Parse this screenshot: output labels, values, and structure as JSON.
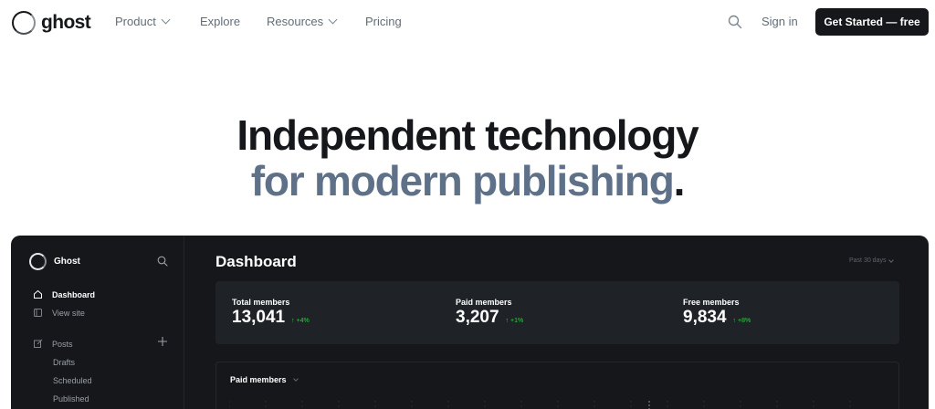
{
  "nav": {
    "brand": "ghost",
    "items": [
      {
        "label": "Product",
        "dropdown": true
      },
      {
        "label": "Explore",
        "dropdown": false
      },
      {
        "label": "Resources",
        "dropdown": true
      },
      {
        "label": "Pricing",
        "dropdown": false
      }
    ],
    "search_icon": "search-icon",
    "signin": "Sign in",
    "cta": "Get Started — free"
  },
  "hero": {
    "line1": "Independent technology",
    "line2": "for modern publishing",
    "period": "."
  },
  "dashboard": {
    "brand": "Ghost",
    "sidebar": {
      "items": [
        {
          "label": "Dashboard",
          "icon": "home-icon",
          "active": true
        },
        {
          "label": "View site",
          "icon": "browser-icon",
          "active": false
        },
        {
          "label": "Posts",
          "icon": "edit-icon",
          "active": false
        }
      ],
      "post_subitems": [
        "Drafts",
        "Scheduled",
        "Published"
      ]
    },
    "title": "Dashboard",
    "range": "Past 30 days",
    "stats": [
      {
        "label": "Total members",
        "value": "13,041",
        "delta": "+4%"
      },
      {
        "label": "Paid members",
        "value": "3,207",
        "delta": "+1%"
      },
      {
        "label": "Free members",
        "value": "9,834",
        "delta": "+8%"
      }
    ],
    "chart_title": "Paid members"
  },
  "colors": {
    "ink": "#15171a",
    "muted": "#626d79",
    "hero_accent": "#5e7188",
    "dash_bg": "#15171a",
    "positive": "#30cf43"
  }
}
